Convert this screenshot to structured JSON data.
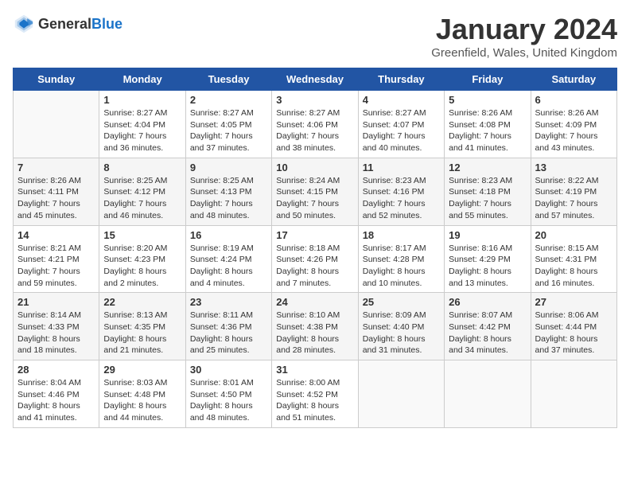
{
  "header": {
    "logo_general": "General",
    "logo_blue": "Blue",
    "title": "January 2024",
    "subtitle": "Greenfield, Wales, United Kingdom"
  },
  "calendar": {
    "days_of_week": [
      "Sunday",
      "Monday",
      "Tuesday",
      "Wednesday",
      "Thursday",
      "Friday",
      "Saturday"
    ],
    "weeks": [
      [
        {
          "day": "",
          "info": ""
        },
        {
          "day": "1",
          "info": "Sunrise: 8:27 AM\nSunset: 4:04 PM\nDaylight: 7 hours\nand 36 minutes."
        },
        {
          "day": "2",
          "info": "Sunrise: 8:27 AM\nSunset: 4:05 PM\nDaylight: 7 hours\nand 37 minutes."
        },
        {
          "day": "3",
          "info": "Sunrise: 8:27 AM\nSunset: 4:06 PM\nDaylight: 7 hours\nand 38 minutes."
        },
        {
          "day": "4",
          "info": "Sunrise: 8:27 AM\nSunset: 4:07 PM\nDaylight: 7 hours\nand 40 minutes."
        },
        {
          "day": "5",
          "info": "Sunrise: 8:26 AM\nSunset: 4:08 PM\nDaylight: 7 hours\nand 41 minutes."
        },
        {
          "day": "6",
          "info": "Sunrise: 8:26 AM\nSunset: 4:09 PM\nDaylight: 7 hours\nand 43 minutes."
        }
      ],
      [
        {
          "day": "7",
          "info": "Sunrise: 8:26 AM\nSunset: 4:11 PM\nDaylight: 7 hours\nand 45 minutes."
        },
        {
          "day": "8",
          "info": "Sunrise: 8:25 AM\nSunset: 4:12 PM\nDaylight: 7 hours\nand 46 minutes."
        },
        {
          "day": "9",
          "info": "Sunrise: 8:25 AM\nSunset: 4:13 PM\nDaylight: 7 hours\nand 48 minutes."
        },
        {
          "day": "10",
          "info": "Sunrise: 8:24 AM\nSunset: 4:15 PM\nDaylight: 7 hours\nand 50 minutes."
        },
        {
          "day": "11",
          "info": "Sunrise: 8:23 AM\nSunset: 4:16 PM\nDaylight: 7 hours\nand 52 minutes."
        },
        {
          "day": "12",
          "info": "Sunrise: 8:23 AM\nSunset: 4:18 PM\nDaylight: 7 hours\nand 55 minutes."
        },
        {
          "day": "13",
          "info": "Sunrise: 8:22 AM\nSunset: 4:19 PM\nDaylight: 7 hours\nand 57 minutes."
        }
      ],
      [
        {
          "day": "14",
          "info": "Sunrise: 8:21 AM\nSunset: 4:21 PM\nDaylight: 7 hours\nand 59 minutes."
        },
        {
          "day": "15",
          "info": "Sunrise: 8:20 AM\nSunset: 4:23 PM\nDaylight: 8 hours\nand 2 minutes."
        },
        {
          "day": "16",
          "info": "Sunrise: 8:19 AM\nSunset: 4:24 PM\nDaylight: 8 hours\nand 4 minutes."
        },
        {
          "day": "17",
          "info": "Sunrise: 8:18 AM\nSunset: 4:26 PM\nDaylight: 8 hours\nand 7 minutes."
        },
        {
          "day": "18",
          "info": "Sunrise: 8:17 AM\nSunset: 4:28 PM\nDaylight: 8 hours\nand 10 minutes."
        },
        {
          "day": "19",
          "info": "Sunrise: 8:16 AM\nSunset: 4:29 PM\nDaylight: 8 hours\nand 13 minutes."
        },
        {
          "day": "20",
          "info": "Sunrise: 8:15 AM\nSunset: 4:31 PM\nDaylight: 8 hours\nand 16 minutes."
        }
      ],
      [
        {
          "day": "21",
          "info": "Sunrise: 8:14 AM\nSunset: 4:33 PM\nDaylight: 8 hours\nand 18 minutes."
        },
        {
          "day": "22",
          "info": "Sunrise: 8:13 AM\nSunset: 4:35 PM\nDaylight: 8 hours\nand 21 minutes."
        },
        {
          "day": "23",
          "info": "Sunrise: 8:11 AM\nSunset: 4:36 PM\nDaylight: 8 hours\nand 25 minutes."
        },
        {
          "day": "24",
          "info": "Sunrise: 8:10 AM\nSunset: 4:38 PM\nDaylight: 8 hours\nand 28 minutes."
        },
        {
          "day": "25",
          "info": "Sunrise: 8:09 AM\nSunset: 4:40 PM\nDaylight: 8 hours\nand 31 minutes."
        },
        {
          "day": "26",
          "info": "Sunrise: 8:07 AM\nSunset: 4:42 PM\nDaylight: 8 hours\nand 34 minutes."
        },
        {
          "day": "27",
          "info": "Sunrise: 8:06 AM\nSunset: 4:44 PM\nDaylight: 8 hours\nand 37 minutes."
        }
      ],
      [
        {
          "day": "28",
          "info": "Sunrise: 8:04 AM\nSunset: 4:46 PM\nDaylight: 8 hours\nand 41 minutes."
        },
        {
          "day": "29",
          "info": "Sunrise: 8:03 AM\nSunset: 4:48 PM\nDaylight: 8 hours\nand 44 minutes."
        },
        {
          "day": "30",
          "info": "Sunrise: 8:01 AM\nSunset: 4:50 PM\nDaylight: 8 hours\nand 48 minutes."
        },
        {
          "day": "31",
          "info": "Sunrise: 8:00 AM\nSunset: 4:52 PM\nDaylight: 8 hours\nand 51 minutes."
        },
        {
          "day": "",
          "info": ""
        },
        {
          "day": "",
          "info": ""
        },
        {
          "day": "",
          "info": ""
        }
      ]
    ]
  }
}
